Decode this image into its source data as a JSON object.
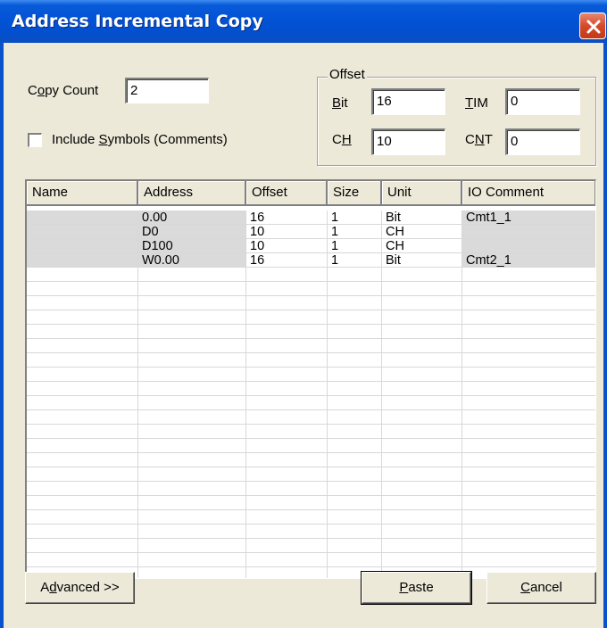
{
  "window": {
    "title": "Address Incremental Copy"
  },
  "copy_count": {
    "label_pre": "C",
    "label_ul": "o",
    "label_post": "py Count",
    "value": "2"
  },
  "include_symbols": {
    "label_pre": "Include ",
    "label_ul": "S",
    "label_post": "ymbols (Comments)",
    "checked": false
  },
  "offset_group": {
    "legend": "Offset",
    "bit": {
      "label_ul": "B",
      "label_post": "it",
      "value": "16"
    },
    "ch": {
      "label_pre": "C",
      "label_ul": "H",
      "value": "10"
    },
    "tim": {
      "label_ul": "T",
      "label_post": "IM",
      "value": "0"
    },
    "cnt": {
      "label_pre": "C",
      "label_ul": "N",
      "label_post": "T",
      "value": "0"
    }
  },
  "table": {
    "columns": [
      "Name",
      "Address",
      "Offset",
      "Size",
      "Unit",
      "IO Comment"
    ],
    "rows": [
      [
        "",
        "0.00",
        "16",
        "1",
        "Bit",
        "Cmt1_1"
      ],
      [
        "",
        "D0",
        "10",
        "1",
        "CH",
        ""
      ],
      [
        "",
        "D100",
        "10",
        "1",
        "CH",
        ""
      ],
      [
        "",
        "W0.00",
        "16",
        "1",
        "Bit",
        "Cmt2_1"
      ]
    ]
  },
  "buttons": {
    "advanced": {
      "label_pre": "A",
      "label_ul": "d",
      "label_post": "vanced >>"
    },
    "paste": {
      "label_pre": "",
      "label_ul": "P",
      "label_post": "aste"
    },
    "cancel": {
      "label_pre": "",
      "label_ul": "C",
      "label_post": "ancel"
    }
  },
  "colors": {
    "titlebar": "#0354d6",
    "face": "#ece9d8",
    "row_fill": "#dadada",
    "close": "#d44a2a"
  },
  "icons": {
    "close": "close-icon"
  }
}
